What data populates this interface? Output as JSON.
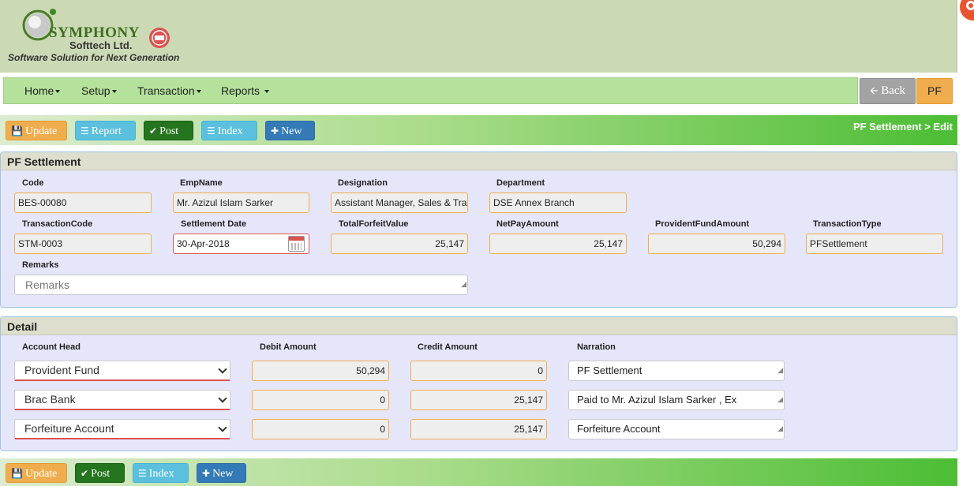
{
  "logo": {
    "name": "SYMPHONY",
    "sub": "Softtech Ltd.",
    "tagline": "Software Solution for Next Generation"
  },
  "nav": {
    "items": [
      "Home",
      "Setup",
      "Transaction",
      "Reports"
    ],
    "back_label": "Back",
    "pf_label": "PF"
  },
  "toolbar": {
    "update": "Update",
    "report": "Report",
    "post": "Post",
    "index": "Index",
    "new": "New",
    "breadcrumb": "PF Settlement > Edit"
  },
  "settlement": {
    "title": "PF Settlement",
    "labels": {
      "code": "Code",
      "emp_name": "EmpName",
      "designation": "Designation",
      "department": "Department",
      "transaction_code": "TransactionCode",
      "settlement_date": "Settlement Date",
      "total_forfeit": "TotalForfeitValue",
      "net_pay": "NetPayAmount",
      "provident_fund": "ProvidentFundAmount",
      "transaction_type": "TransactionType",
      "remarks": "Remarks"
    },
    "values": {
      "code": "BES-00080",
      "emp_name": "Mr. Azizul Islam Sarker",
      "designation": "Assistant Manager, Sales & Tra",
      "department": "DSE Annex Branch",
      "transaction_code": "STM-0003",
      "settlement_date": "30-Apr-2018",
      "total_forfeit": "25,147",
      "net_pay": "25,147",
      "provident_fund": "50,294",
      "transaction_type": "PFSettlement"
    },
    "remarks_placeholder": "Remarks"
  },
  "detail": {
    "title": "Detail",
    "headers": {
      "account_head": "Account Head",
      "debit": "Debit Amount",
      "credit": "Credit Amount",
      "narration": "Narration"
    },
    "rows": [
      {
        "account": "Provident Fund",
        "debit": "50,294",
        "credit": "0",
        "narration": "PF Settlement"
      },
      {
        "account": "Brac Bank",
        "debit": "0",
        "credit": "25,147",
        "narration": "Paid to Mr. Azizul Islam Sarker , Ex"
      },
      {
        "account": "Forfeiture Account",
        "debit": "0",
        "credit": "25,147",
        "narration": "Forfeiture Account"
      }
    ]
  },
  "colors": {
    "header_bg": "#cbd9b5",
    "nav_bg": "#b4e29a",
    "warning": "#f0ad4e",
    "info": "#5bc0de",
    "success_dark": "#24751d",
    "primary": "#337ab7",
    "panel_bg": "#e6e6fa"
  }
}
